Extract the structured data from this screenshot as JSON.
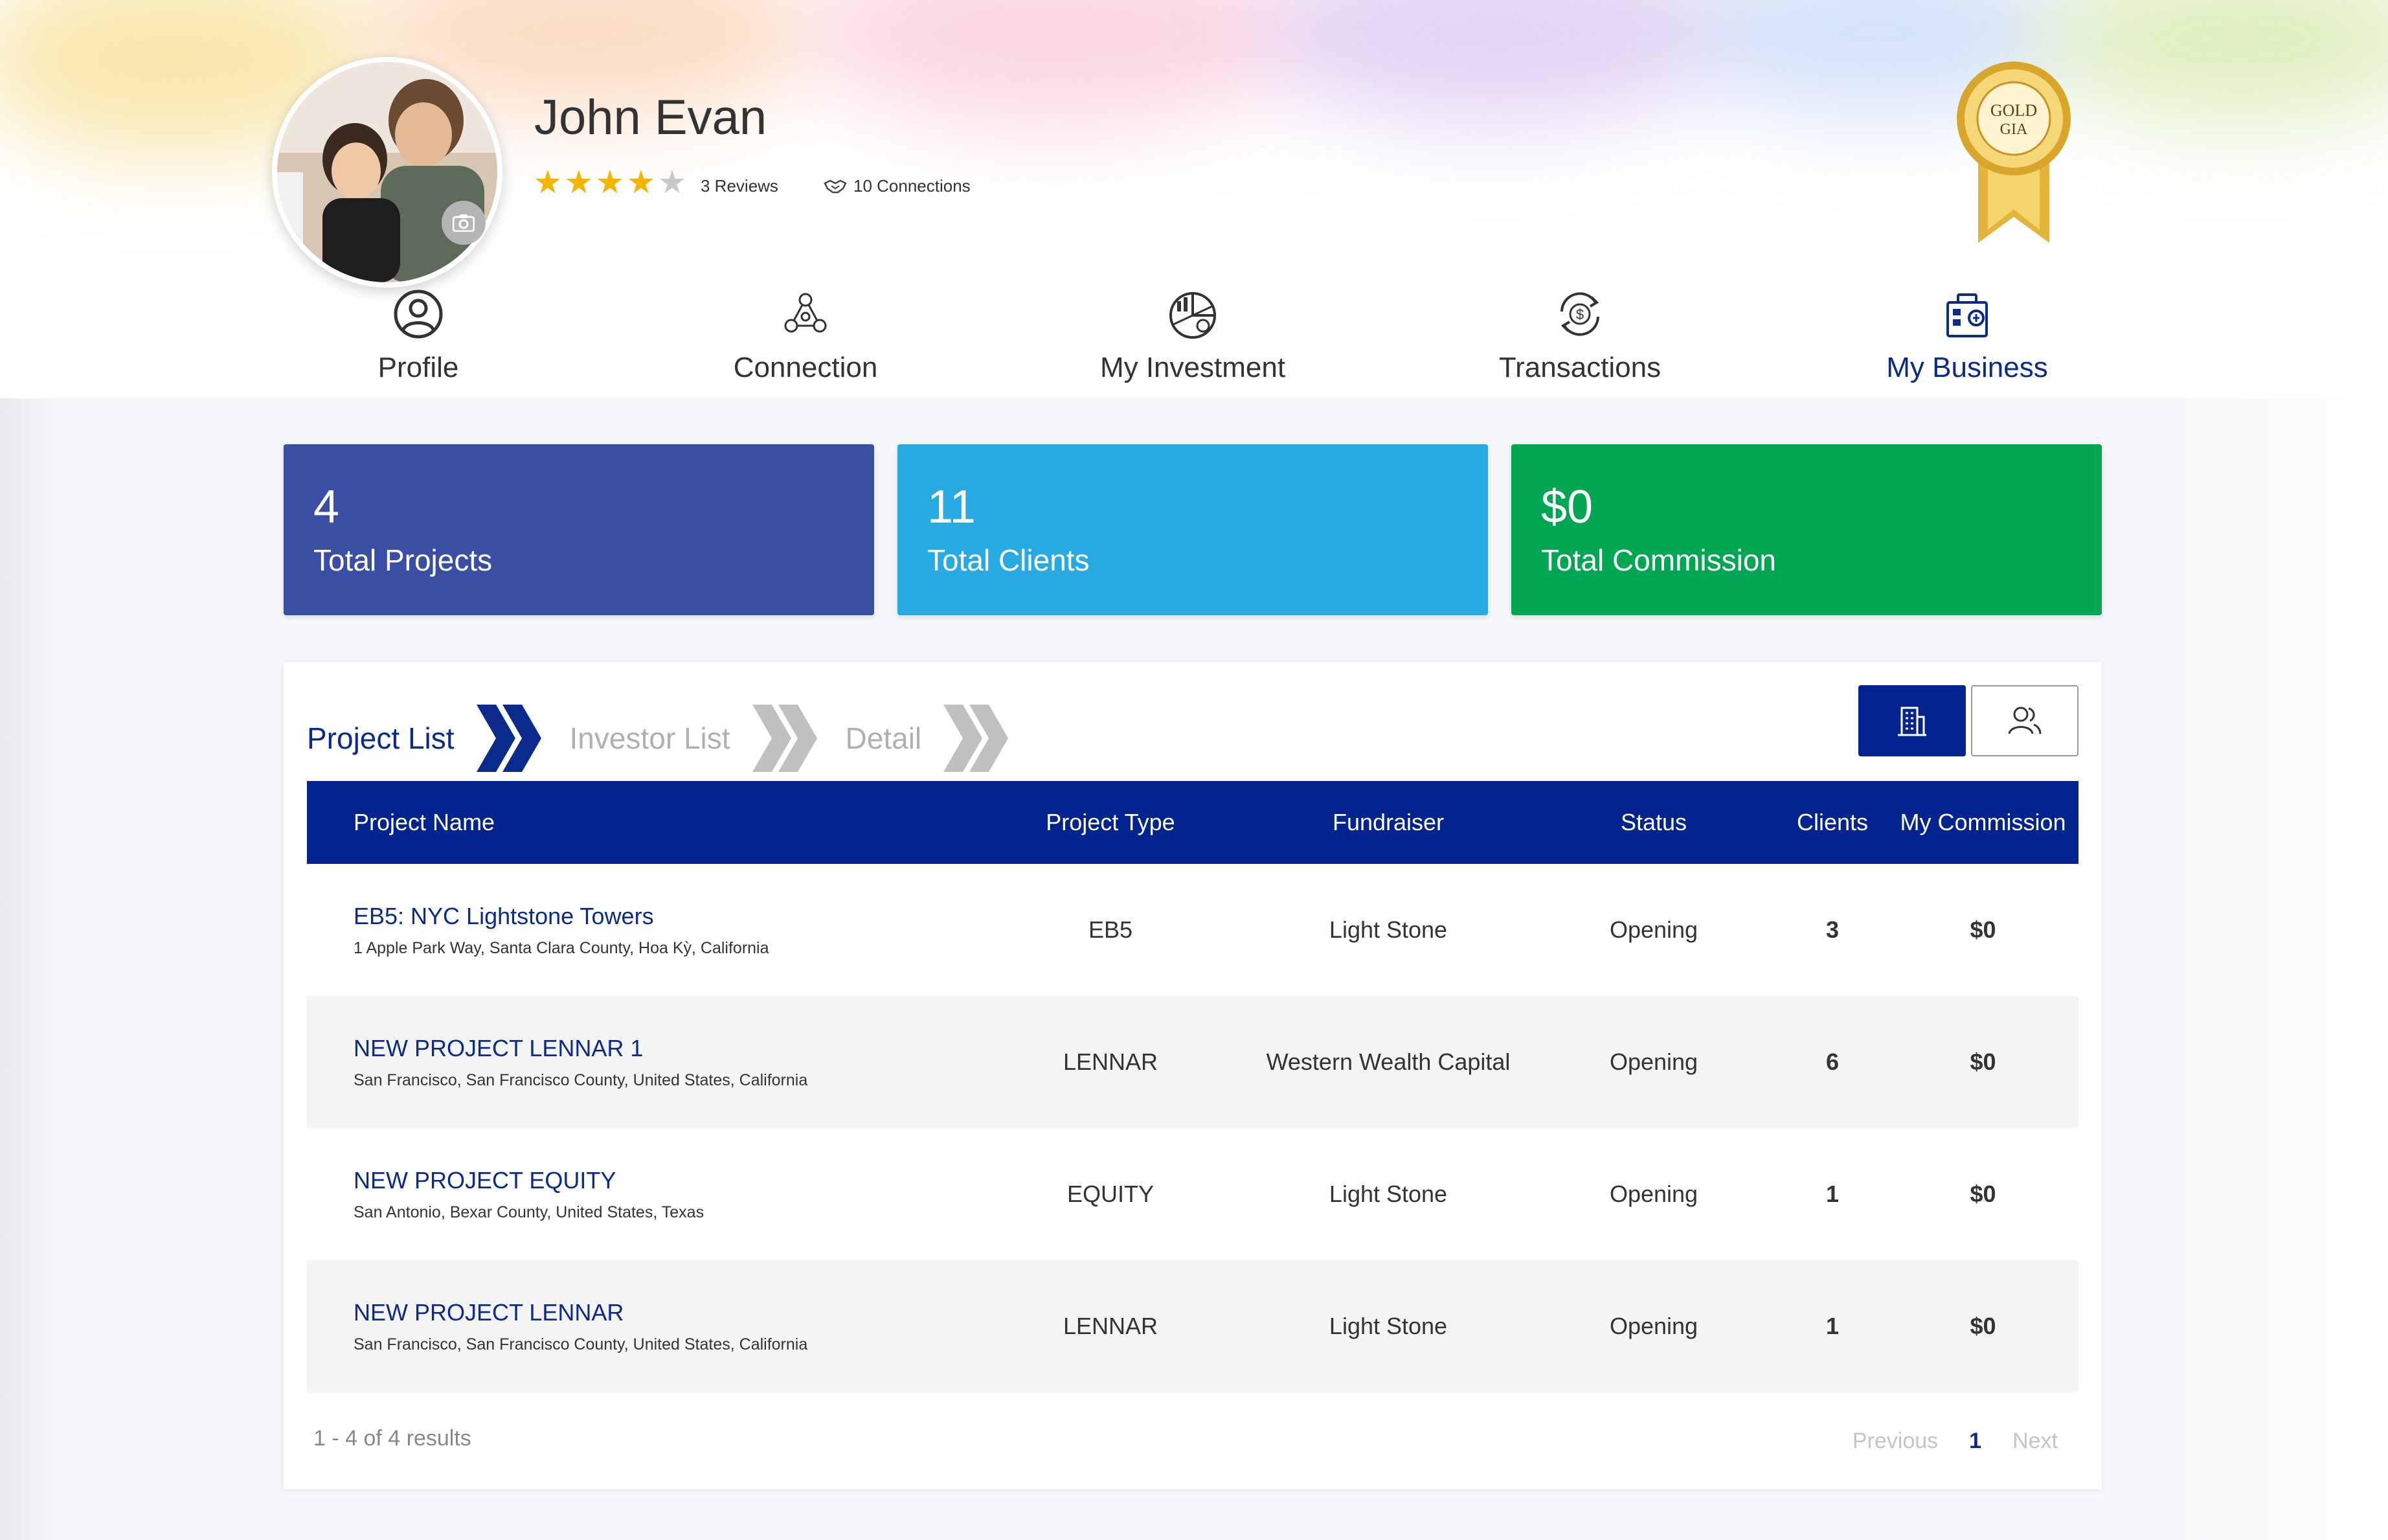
{
  "profile": {
    "name": "John Evan",
    "rating": 4,
    "max_rating": 5,
    "reviews_label": "3 Reviews",
    "connections_label": "10 Connections",
    "badge_text": "GOLD GIA"
  },
  "nav": {
    "tabs": [
      {
        "label": "Profile",
        "icon": "user-icon",
        "active": false
      },
      {
        "label": "Connection",
        "icon": "network-icon",
        "active": false
      },
      {
        "label": "My Investment",
        "icon": "investment-chart-icon",
        "active": false
      },
      {
        "label": "Transactions",
        "icon": "transactions-icon",
        "active": false
      },
      {
        "label": "My Business",
        "icon": "business-icon",
        "active": true
      }
    ]
  },
  "stats": [
    {
      "value": "4",
      "label": "Total Projects",
      "color": "#3a4fa3"
    },
    {
      "value": "11",
      "label": "Total Clients",
      "color": "#27aae1"
    },
    {
      "value": "$0",
      "label": "Total Commission",
      "color": "#00a651"
    }
  ],
  "steps": [
    {
      "label": "Project List",
      "active": true
    },
    {
      "label": "Investor List",
      "active": false
    },
    {
      "label": "Detail",
      "active": false
    }
  ],
  "table": {
    "headers": [
      "Project Name",
      "Project Type",
      "Fundraiser",
      "Status",
      "Clients",
      "My Commission"
    ],
    "rows": [
      {
        "name": "EB5: NYC Lightstone Towers",
        "address": "1 Apple Park Way, Santa Clara County, Hoa Kỳ, California",
        "type": "EB5",
        "fundraiser": "Light Stone",
        "status": "Opening",
        "clients": "3",
        "commission": "$0"
      },
      {
        "name": "NEW PROJECT LENNAR 1",
        "address": "San Francisco, San Francisco County, United States, California",
        "type": "LENNAR",
        "fundraiser": "Western Wealth Capital",
        "status": "Opening",
        "clients": "6",
        "commission": "$0"
      },
      {
        "name": "NEW PROJECT EQUITY",
        "address": "San Antonio, Bexar County, United States, Texas",
        "type": "EQUITY",
        "fundraiser": "Light Stone",
        "status": "Opening",
        "clients": "1",
        "commission": "$0"
      },
      {
        "name": "NEW PROJECT LENNAR",
        "address": "San Francisco, San Francisco County, United States, California",
        "type": "LENNAR",
        "fundraiser": "Light Stone",
        "status": "Opening",
        "clients": "1",
        "commission": "$0"
      }
    ]
  },
  "pagination": {
    "results": "1 - 4 of 4 results",
    "previous": "Previous",
    "current": "1",
    "next": "Next"
  },
  "colors": {
    "primary_navy": "#03238f",
    "star_gold": "#f4b400",
    "star_empty": "#c8c8c8",
    "step_inactive": "#b0b0b0"
  }
}
